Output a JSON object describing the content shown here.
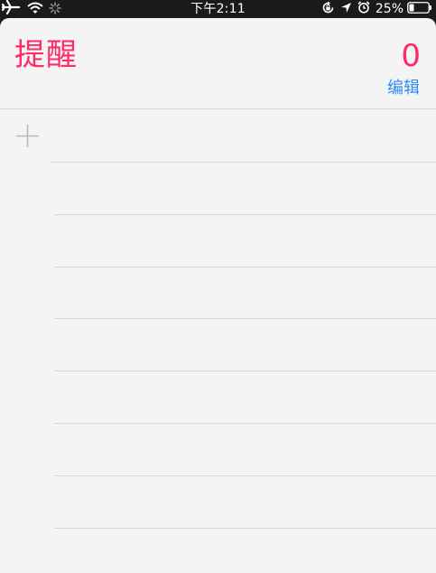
{
  "status_bar": {
    "time": "下午2:11",
    "battery_percent": "25%",
    "battery_level": 0.25,
    "left_icons": [
      "airplane-icon",
      "wifi-icon",
      "activity-spinner-icon"
    ],
    "right_icons": [
      "orientation-lock-icon",
      "location-icon",
      "alarm-icon",
      "battery-icon"
    ]
  },
  "header": {
    "title": "提醒",
    "count": "0",
    "edit_label": "编辑"
  },
  "list": {
    "add_icon": "plus-icon",
    "empty_rows": 8
  },
  "colors": {
    "accent": "#ff2a68",
    "link": "#2f8cf0",
    "background": "#f4f4f4",
    "status_bar": "#1a1a1a"
  }
}
